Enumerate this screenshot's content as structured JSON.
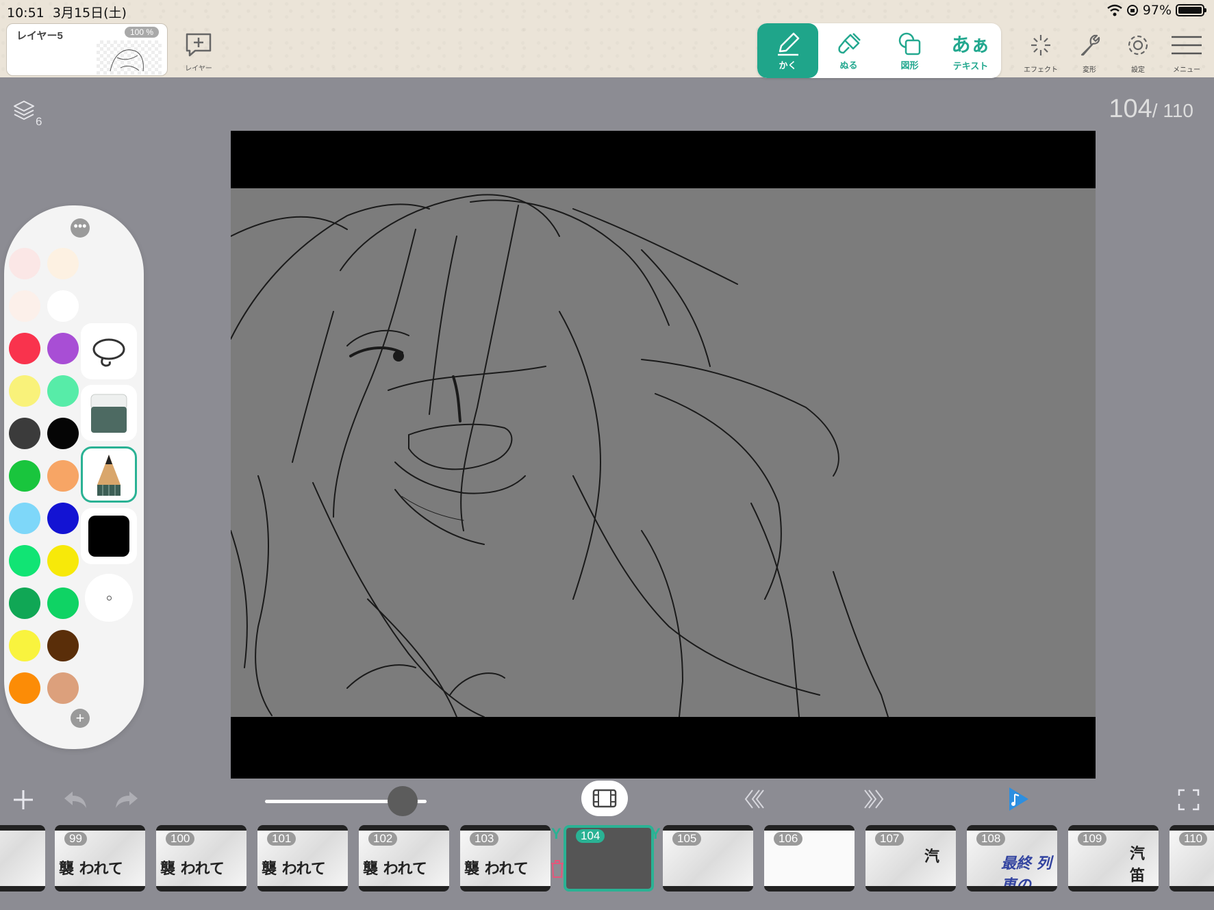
{
  "status": {
    "time": "10:51",
    "date": "3月15日(土)",
    "battery": "97%"
  },
  "layer_panel": {
    "name": "レイヤー5",
    "opacity": "100 %",
    "add_label": "レイヤー"
  },
  "tools": [
    {
      "id": "draw",
      "label": "かく",
      "icon": "pencil-icon",
      "active": true
    },
    {
      "id": "fill",
      "label": "ぬる",
      "icon": "brush-icon",
      "active": false
    },
    {
      "id": "shape",
      "label": "図形",
      "icon": "shape-icon",
      "active": false
    },
    {
      "id": "text",
      "label": "テキスト",
      "glyph": "あぁ",
      "icon": "text-icon",
      "active": false
    }
  ],
  "right_tools": [
    {
      "label": "エフェクト",
      "icon": "sparkle-icon"
    },
    {
      "label": "変形",
      "icon": "wrench-icon"
    },
    {
      "label": "設定",
      "icon": "gear-icon"
    },
    {
      "label": "メニュー",
      "icon": "hamburger-icon"
    }
  ],
  "layers_count": "6",
  "frame": {
    "current": "104",
    "total": "/ 110"
  },
  "palette": {
    "more": "•••",
    "add": "+",
    "colors": [
      "#fbe7e6",
      "#fdf1e2",
      "#fcf0ea",
      "#ffffff",
      "#f9334d",
      "#a84ed5",
      "#f9f27a",
      "#57eca8",
      "#3b3b3b",
      "#050505",
      "#19c53d",
      "#f7a565",
      "#7ed7f9",
      "#1313d3",
      "#11e474",
      "#f7e909",
      "#10a755",
      "#0fd364",
      "#f9f33e",
      "#5a2e09",
      "#fc8c06",
      "#dca07c"
    ],
    "current_color": "#000000"
  },
  "frames": [
    {
      "num": "",
      "text": ""
    },
    {
      "num": "99",
      "text": "襲 われて"
    },
    {
      "num": "100",
      "text": "襲 われて"
    },
    {
      "num": "101",
      "text": "襲 われて"
    },
    {
      "num": "102",
      "text": "襲 われて"
    },
    {
      "num": "103",
      "text": "襲 われて"
    },
    {
      "num": "104",
      "text": ""
    },
    {
      "num": "105",
      "text": ""
    },
    {
      "num": "106",
      "text": ""
    },
    {
      "num": "107",
      "text": "汽"
    },
    {
      "num": "108",
      "text": "最終 列車の"
    },
    {
      "num": "109",
      "text": "汽笛"
    },
    {
      "num": "110",
      "text": ""
    }
  ]
}
